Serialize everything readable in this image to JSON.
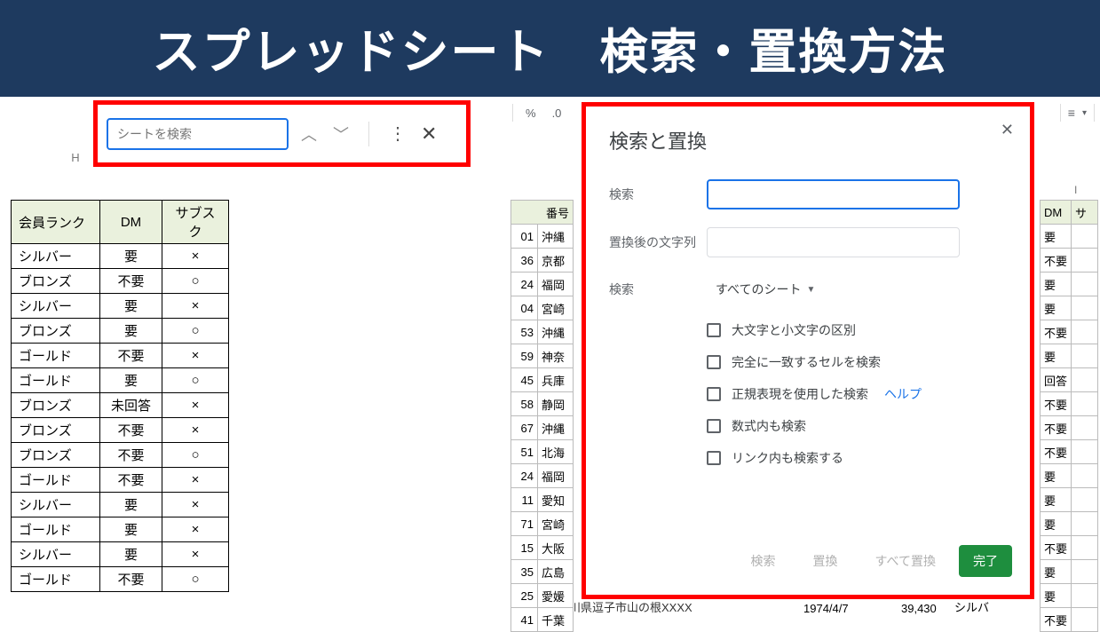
{
  "banner": "スプレッドシート　検索・置換方法",
  "left": {
    "search_placeholder": "シートを検索",
    "col_letter": "H",
    "headers": [
      "会員ランク",
      "DM",
      "サブスク"
    ],
    "rows": [
      [
        "シルバー",
        "要",
        "×"
      ],
      [
        "ブロンズ",
        "不要",
        "○"
      ],
      [
        "シルバー",
        "要",
        "×"
      ],
      [
        "ブロンズ",
        "要",
        "○"
      ],
      [
        "ゴールド",
        "不要",
        "×"
      ],
      [
        "ゴールド",
        "要",
        "○"
      ],
      [
        "ブロンズ",
        "未回答",
        "×"
      ],
      [
        "ブロンズ",
        "不要",
        "×"
      ],
      [
        "ブロンズ",
        "不要",
        "○"
      ],
      [
        "ゴールド",
        "不要",
        "×"
      ],
      [
        "シルバー",
        "要",
        "×"
      ],
      [
        "ゴールド",
        "要",
        "×"
      ],
      [
        "シルバー",
        "要",
        "×"
      ],
      [
        "ゴールド",
        "不要",
        "○"
      ]
    ]
  },
  "right": {
    "toolbar_frag": [
      "%",
      ".0"
    ],
    "dialog_title": "検索と置換",
    "label_search": "検索",
    "label_replace": "置換後の文字列",
    "label_scope": "検索",
    "scope_value": "すべてのシート",
    "chk1": "大文字と小文字の区別",
    "chk2": "完全に一致するセルを検索",
    "chk3": "正規表現を使用した検索",
    "help": "ヘルプ",
    "chk4": "数式内も検索",
    "chk5": "リンク内も検索する",
    "btn_find": "検索",
    "btn_replace": "置換",
    "btn_replace_all": "すべて置換",
    "btn_done": "完了",
    "bg_header": "番号",
    "bg_rows": [
      [
        "01",
        "沖縄"
      ],
      [
        "36",
        "京都"
      ],
      [
        "24",
        "福岡"
      ],
      [
        "04",
        "宮崎"
      ],
      [
        "53",
        "沖縄"
      ],
      [
        "59",
        "神奈"
      ],
      [
        "45",
        "兵庫"
      ],
      [
        "58",
        "静岡"
      ],
      [
        "67",
        "沖縄"
      ],
      [
        "51",
        "北海"
      ],
      [
        "24",
        "福岡"
      ],
      [
        "11",
        "愛知"
      ],
      [
        "71",
        "宮崎"
      ],
      [
        "15",
        "大阪"
      ],
      [
        "35",
        "広島"
      ],
      [
        "25",
        "愛媛"
      ],
      [
        "41",
        "千葉"
      ]
    ],
    "bg2_header": [
      "DM",
      "サ"
    ],
    "bg2_rows": [
      [
        "要",
        ""
      ],
      [
        "不要",
        ""
      ],
      [
        "要",
        ""
      ],
      [
        "要",
        ""
      ],
      [
        "不要",
        ""
      ],
      [
        "要",
        ""
      ],
      [
        "回答",
        ""
      ],
      [
        "不要",
        ""
      ],
      [
        "不要",
        ""
      ],
      [
        "不要",
        ""
      ],
      [
        "要",
        ""
      ],
      [
        "要",
        ""
      ],
      [
        "要",
        ""
      ],
      [
        "不要",
        ""
      ],
      [
        "要",
        ""
      ],
      [
        "要",
        ""
      ],
      [
        "不要",
        ""
      ]
    ],
    "col_I": "I",
    "bottom_text": "神奈川県逗子市山の根XXXX",
    "bottom_date": "1974/4/7",
    "bottom_salary": "39,430",
    "bottom_rank": "シルバ"
  }
}
